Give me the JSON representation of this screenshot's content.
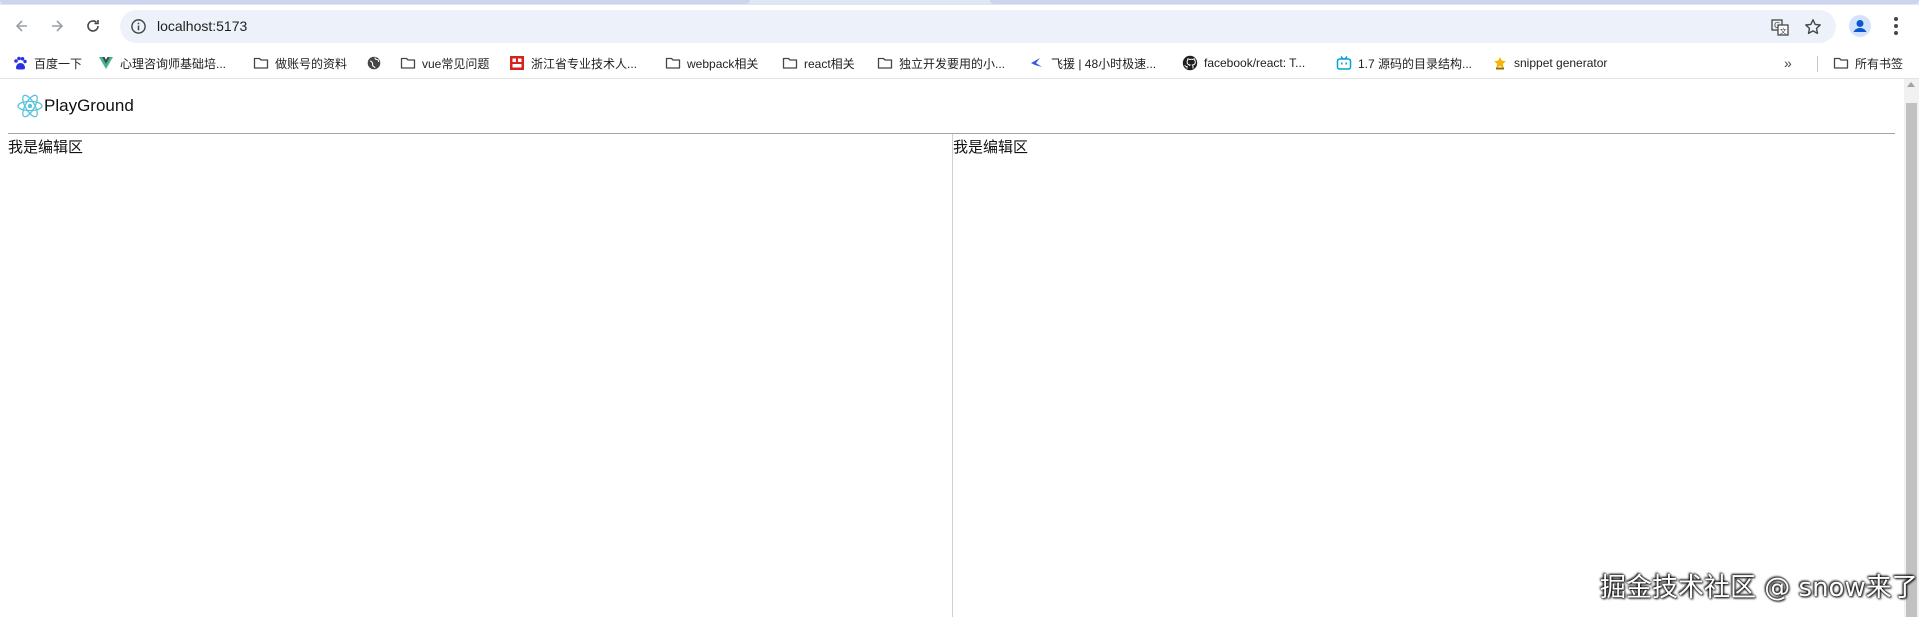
{
  "browser": {
    "address_url": "localhost:5173",
    "icons": {
      "back": "back-arrow-icon",
      "forward": "forward-arrow-icon",
      "reload": "reload-icon",
      "site_info": "info-icon",
      "translate": "translate-icon",
      "bookmark": "star-icon",
      "profile": "profile-icon",
      "menu": "kebab-menu-icon"
    },
    "bookmarks": [
      {
        "label": "百度一下",
        "icon": "baidu-paw-icon"
      },
      {
        "label": "心理咨询师基础培...",
        "icon": "vue-logo-icon"
      },
      {
        "label": "做账号的资料",
        "icon": "folder-icon"
      },
      {
        "label": "",
        "icon": "globe-icon"
      },
      {
        "label": "vue常见问题",
        "icon": "folder-icon"
      },
      {
        "label": "浙江省专业技术人...",
        "icon": "red-seal-icon"
      },
      {
        "label": "webpack相关",
        "icon": "folder-icon"
      },
      {
        "label": "react相关",
        "icon": "folder-icon"
      },
      {
        "label": "独立开发要用的小...",
        "icon": "folder-icon"
      },
      {
        "label": "飞援 | 48小时极速...",
        "icon": "bird-icon"
      },
      {
        "label": "facebook/react: T...",
        "icon": "github-icon"
      },
      {
        "label": "1.7 源码的目录结构...",
        "icon": "bilibili-icon"
      },
      {
        "label": "snippet generator",
        "icon": "star-badge-icon"
      }
    ],
    "more_bookmarks_glyph": "»",
    "all_bookmarks_label": "所有书签"
  },
  "app": {
    "brand": "PlayGround",
    "left_pane_text": "我是编辑区",
    "right_pane_text": "我是编辑区"
  },
  "watermark": "掘金技术社区 @ snow来了",
  "colors": {
    "omnibox_bg": "#edf2fa",
    "react_logo": "#58c4dc",
    "header_border": "#a3a3a3"
  }
}
